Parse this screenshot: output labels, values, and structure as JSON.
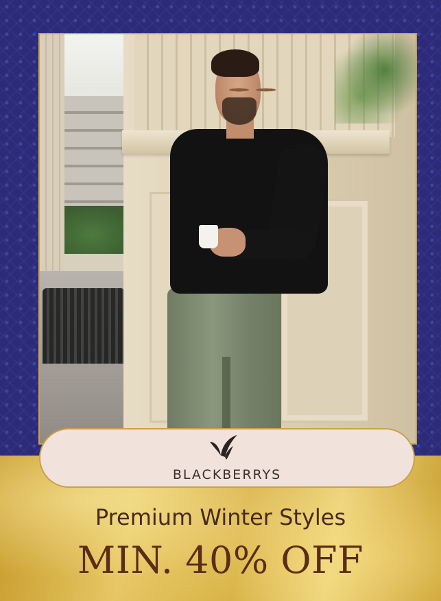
{
  "banner": {
    "brand_name": "BLACKBERRYS",
    "subtitle": "Premium Winter Styles",
    "offer": "MIN. 40% OFF"
  },
  "colors": {
    "navy_background": "#2b2b7a",
    "gold_background": "#d3ab3e",
    "pill_background": "#f1e3dc",
    "text_brown": "#5a2d16"
  },
  "icons": {
    "logo": "blackberrys-bird-logo-icon"
  }
}
